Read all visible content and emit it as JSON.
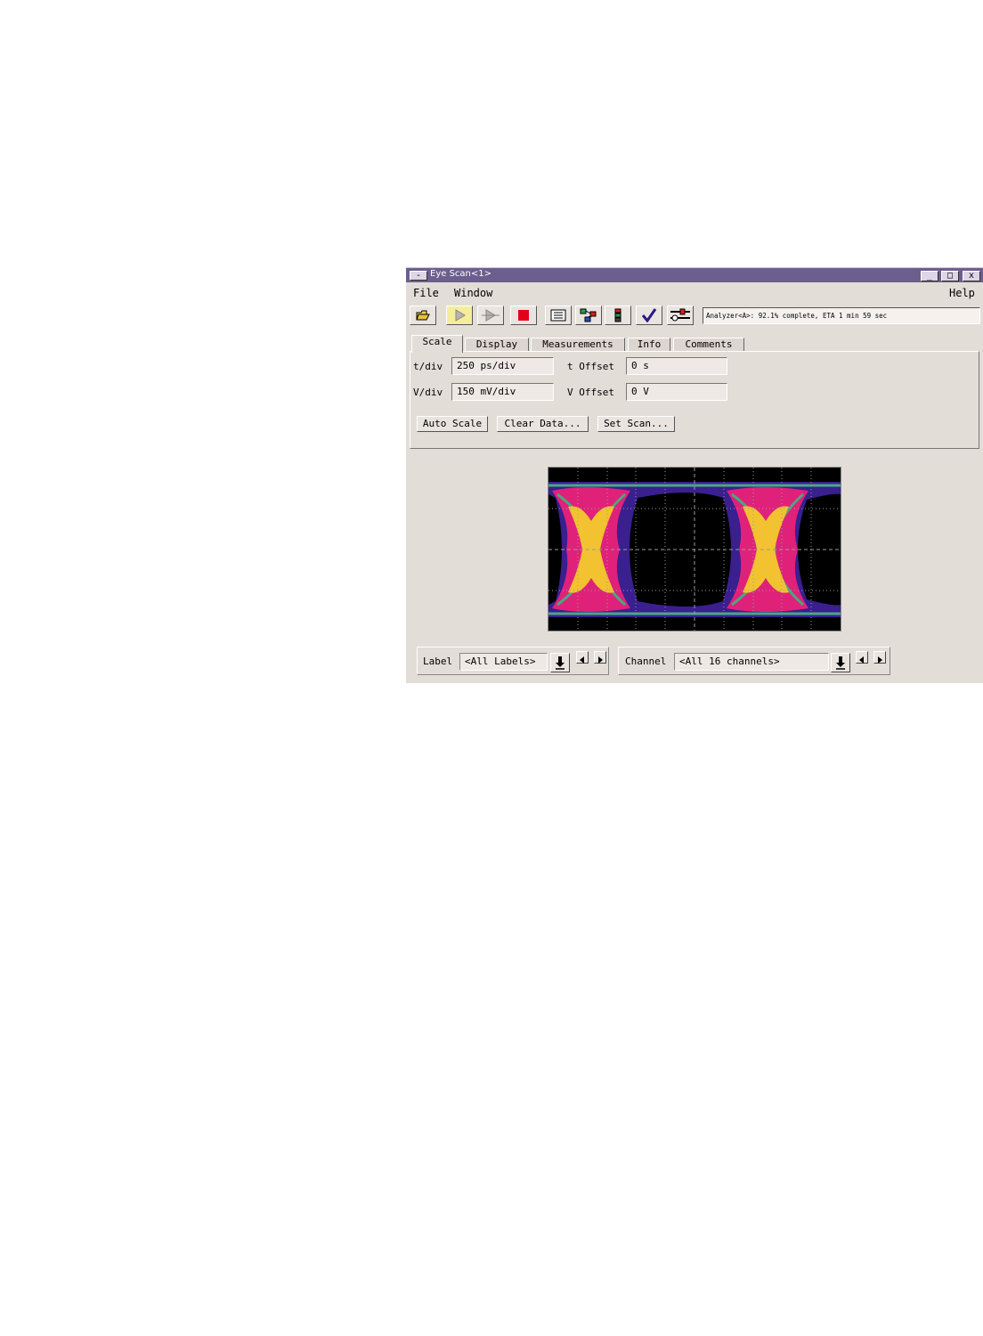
{
  "window": {
    "title": "Eye Scan<1>",
    "minimize_label": "_",
    "maximize_label": "□",
    "close_label": "x",
    "system_menu_label": "-"
  },
  "menu": {
    "file": "File",
    "window": "Window",
    "help": "Help"
  },
  "toolbar": {
    "buttons": [
      "open-folder-icon",
      "run-icon",
      "run-repetitive-icon",
      "stop-icon",
      "listing-icon",
      "overview-icon",
      "markers-icon",
      "check-icon",
      "settings-icon"
    ],
    "status": "Analyzer<A>:  92.1% complete, ETA 1 min 59 sec"
  },
  "tabs": [
    "Scale",
    "Display",
    "Measurements",
    "Info",
    "Comments"
  ],
  "scale": {
    "tdiv_label": "t/div",
    "tdiv_value": "250 ps/div",
    "toffset_label": "t Offset",
    "toffset_value": "0 s",
    "vdiv_label": "V/div",
    "vdiv_value": "150 mV/div",
    "voffset_label": "V Offset",
    "voffset_value": "0 V",
    "auto_scale": "Auto Scale",
    "clear_data": "Clear Data...",
    "set_scan": "Set Scan..."
  },
  "selectors": {
    "label_caption": "Label",
    "label_value": "<All Labels>",
    "channel_caption": "Channel",
    "channel_value": "<All 16 channels>"
  },
  "colors": {
    "titlebar": "#6b5f8e",
    "window_bg": "#e3ddd8",
    "eye_background": "#000000",
    "eye_layers": [
      "#3a1f8f",
      "#e0217a",
      "#48a880",
      "#f2c230"
    ]
  }
}
